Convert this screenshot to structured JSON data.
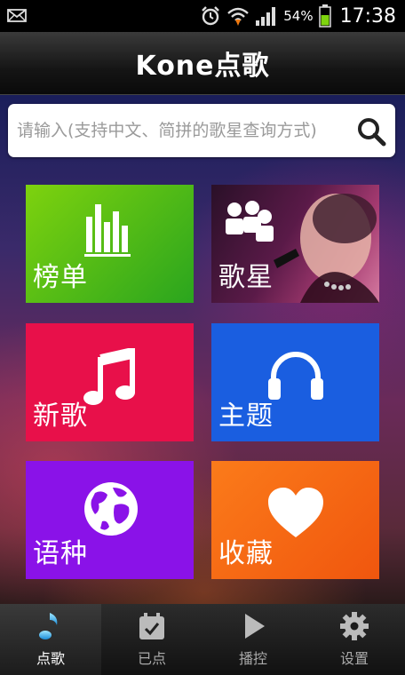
{
  "status": {
    "battery": "54%",
    "time": "17:38"
  },
  "header": {
    "title": "Kone点歌"
  },
  "search": {
    "placeholder": "请输入(支持中文、简拼的歌星查询方式)"
  },
  "tiles": [
    {
      "label": "榜单",
      "icon": "chart-bars-icon",
      "color": "#5cbf16"
    },
    {
      "label": "歌星",
      "icon": "people-icon",
      "color": "#7a2a5a"
    },
    {
      "label": "新歌",
      "icon": "music-note-icon",
      "color": "#e8104a"
    },
    {
      "label": "主题",
      "icon": "headphones-icon",
      "color": "#1a5ee0"
    },
    {
      "label": "语种",
      "icon": "globe-icon",
      "color": "#8a12e8"
    },
    {
      "label": "收藏",
      "icon": "heart-icon",
      "color": "#f26a12"
    }
  ],
  "tabs": [
    {
      "label": "点歌",
      "icon": "music-note-icon",
      "active": true
    },
    {
      "label": "已点",
      "icon": "calendar-check-icon",
      "active": false
    },
    {
      "label": "播控",
      "icon": "play-icon",
      "active": false
    },
    {
      "label": "设置",
      "icon": "gear-icon",
      "active": false
    }
  ]
}
